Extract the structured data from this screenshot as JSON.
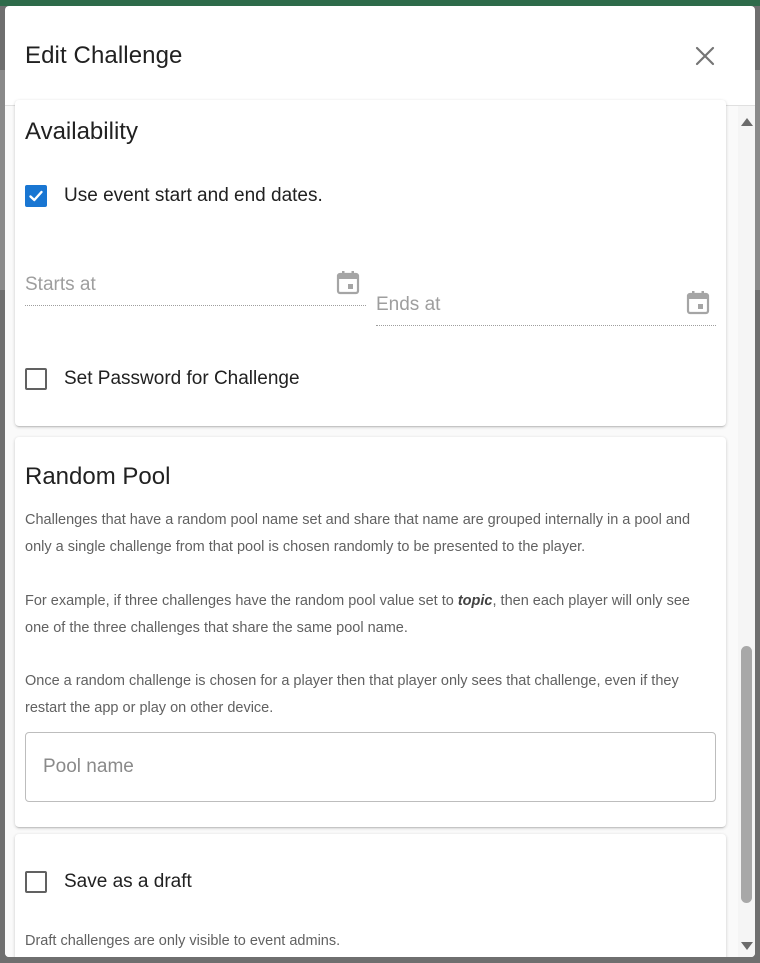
{
  "dialog": {
    "title": "Edit Challenge"
  },
  "availability": {
    "title": "Availability",
    "use_event_dates_label": "Use event start and end dates.",
    "use_event_dates_checked": true,
    "starts_at_label": "Starts at",
    "ends_at_label": "Ends at",
    "set_password_label": "Set Password for Challenge",
    "set_password_checked": false
  },
  "random_pool": {
    "title": "Random Pool",
    "para1": "Challenges that have a random pool name set and share that name are grouped internally in a pool and only a single challenge from that pool is chosen randomly to be presented to the player.",
    "para2_before": "For example, if three challenges have the random pool value set to ",
    "para2_emph": "topic",
    "para2_after": ", then each player will only see one of the three challenges that share the same pool name.",
    "para3": "Once a random challenge is chosen for a player then that player only sees that challenge, even if they restart the app or play on other device.",
    "pool_name_placeholder": "Pool name",
    "pool_name_value": ""
  },
  "draft": {
    "save_as_draft_label": "Save as a draft",
    "save_as_draft_checked": false,
    "help_text": "Draft challenges are only visible to event admins."
  },
  "icons": {
    "close": "close-icon",
    "calendar": "calendar-icon",
    "check": "check-icon"
  },
  "colors": {
    "accent": "#1976d2",
    "header_bar": "#2e6b4a"
  }
}
